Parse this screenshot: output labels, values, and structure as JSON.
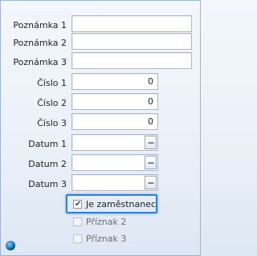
{
  "form": {
    "fields": [
      {
        "label": "Poznámka 1",
        "value": ""
      },
      {
        "label": "Poznámka 2",
        "value": ""
      },
      {
        "label": "Poznámka 3",
        "value": ""
      },
      {
        "label": "Číslo 1",
        "value": "0"
      },
      {
        "label": "Číslo 2",
        "value": "0"
      },
      {
        "label": "Číslo 3",
        "value": "0"
      },
      {
        "label": "Datum 1",
        "value": "",
        "button": "..."
      },
      {
        "label": "Datum 2",
        "value": "",
        "button": "..."
      },
      {
        "label": "Datum 3",
        "value": "",
        "button": "..."
      }
    ],
    "checkboxes": [
      {
        "label": "Je zaměstnanec",
        "checked": true,
        "enabled": true,
        "focused": true
      },
      {
        "label": "Příznak 2",
        "checked": false,
        "enabled": false
      },
      {
        "label": "Příznak 3",
        "checked": false,
        "enabled": false
      }
    ]
  },
  "icons": {
    "status": "globe-icon"
  },
  "colors": {
    "focus_outline": "#2f7fd6",
    "background": "#ebf1f9",
    "field_border": "#aab8c9"
  }
}
